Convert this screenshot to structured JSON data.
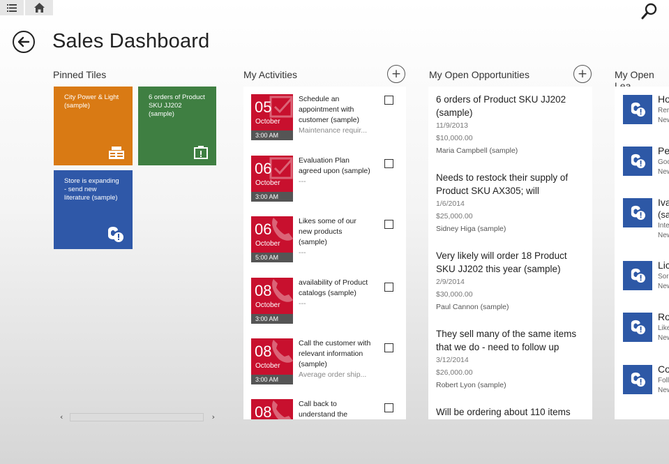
{
  "header": {
    "title": "Sales Dashboard",
    "icons": [
      "list-icon",
      "home-icon",
      "search-icon",
      "back-arrow-icon"
    ]
  },
  "pinned": {
    "heading": "Pinned Tiles",
    "tiles": [
      {
        "label": "City Power & Light (sample)",
        "color": "#d97a14",
        "icon": "account-icon"
      },
      {
        "label": "6 orders of Product SKU JJ202 (sample)",
        "color": "#3f7f42",
        "icon": "opportunity-icon"
      },
      {
        "label": "Store is expanding - send new literature (sample)",
        "color": "#2f58a8",
        "icon": "lead-phone-icon"
      }
    ]
  },
  "activities": {
    "heading": "My Activities",
    "add": "+",
    "items": [
      {
        "day": "05",
        "month": "October",
        "time": "3:00 AM",
        "title": "Schedule an appointment with customer (sample)",
        "sub": "Maintenance requir..."
      },
      {
        "day": "06",
        "month": "October",
        "time": "3:00 AM",
        "title": "Evaluation Plan agreed upon (sample)",
        "sub": "---"
      },
      {
        "day": "06",
        "month": "October",
        "time": "5:00 AM",
        "title": "Likes some of our new products (sample)",
        "sub": "---"
      },
      {
        "day": "08",
        "month": "October",
        "time": "3:00 AM",
        "title": "availability of Product catalogs (sample)",
        "sub": "---"
      },
      {
        "day": "08",
        "month": "October",
        "time": "3:00 AM",
        "title": "Call the customer with relevant information (sample)",
        "sub": "Average order ship..."
      },
      {
        "day": "08",
        "month": "",
        "time": "",
        "title": "Call back to understand the",
        "sub": ""
      }
    ]
  },
  "opportunities": {
    "heading": "My Open Opportunities",
    "add": "+",
    "items": [
      {
        "title": "6 orders of Product SKU JJ202 (sample)",
        "date": "11/9/2013",
        "amount": "$10,000.00",
        "owner": "Maria Campbell (sample)"
      },
      {
        "title": "Needs to restock their supply of Product SKU AX305; will",
        "date": "1/6/2014",
        "amount": "$25,000.00",
        "owner": "Sidney Higa (sample)"
      },
      {
        "title": "Very likely will order 18 Product SKU JJ202 this year (sample)",
        "date": "2/9/2014",
        "amount": "$30,000.00",
        "owner": "Paul Cannon (sample)"
      },
      {
        "title": "They sell many of the same items that we do - need to follow up",
        "date": "3/12/2014",
        "amount": "$26,000.00",
        "owner": "Robert Lyon (sample)"
      },
      {
        "title": "Will be ordering about 110 items",
        "date": "",
        "amount": "",
        "owner": ""
      }
    ]
  },
  "leads": {
    "heading": "My Open Lea",
    "items": [
      {
        "name": "Ho",
        "s1": "Rer",
        "s2": "New"
      },
      {
        "name": "Pe",
        "s1": "Goo",
        "s2": "New"
      },
      {
        "name": "Iva",
        "s1": "(sa",
        "s2": "Inte"
      },
      {
        "name": "Lic",
        "s1": "Sor",
        "s2": "New"
      },
      {
        "name": "Ro",
        "s1": "Like",
        "s2": "New"
      },
      {
        "name": "Co",
        "s1": "Foll",
        "s2": "New"
      }
    ],
    "extra": [
      "New"
    ]
  },
  "scrollbar": {
    "left": "‹",
    "right": "›"
  },
  "colors": {
    "activity_red": "#c8102e",
    "lead_blue": "#2d58a6"
  }
}
